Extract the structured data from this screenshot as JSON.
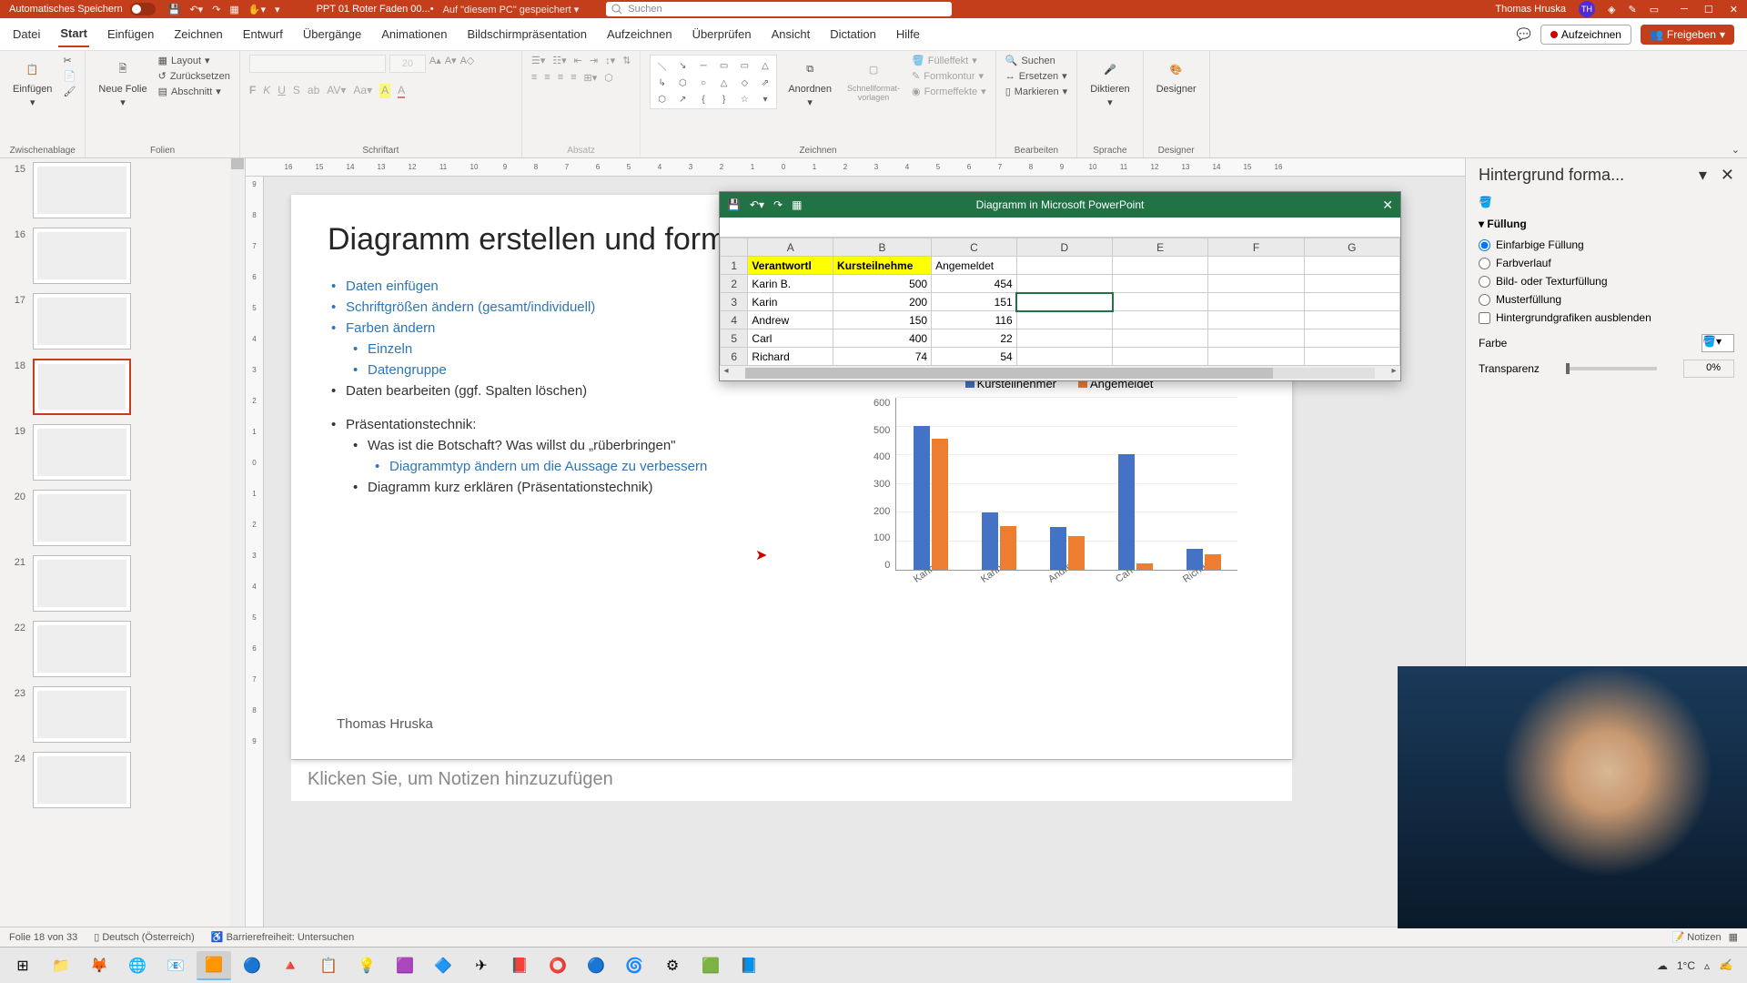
{
  "titlebar": {
    "autosave": "Automatisches Speichern",
    "doc": "PPT 01 Roter Faden 00...",
    "saved": "Auf \"diesem PC\" gespeichert",
    "search_placeholder": "Suchen",
    "user": "Thomas Hruska",
    "initials": "TH"
  },
  "tabs": {
    "items": [
      "Datei",
      "Start",
      "Einfügen",
      "Zeichnen",
      "Entwurf",
      "Übergänge",
      "Animationen",
      "Bildschirmpräsentation",
      "Aufzeichnen",
      "Überprüfen",
      "Ansicht",
      "Dictation",
      "Hilfe"
    ],
    "active": 1,
    "record": "Aufzeichnen",
    "share": "Freigeben"
  },
  "ribbon": {
    "paste": "Einfügen",
    "clipboard": "Zwischenablage",
    "newslide": "Neue Folie",
    "layout": "Layout",
    "reset": "Zurücksetzen",
    "section": "Abschnitt",
    "slides": "Folien",
    "font_size": "20",
    "font_group": "Schriftart",
    "para_group": "Absatz",
    "draw_group": "Zeichnen",
    "arrange": "Anordnen",
    "quickfmt": "Schnellformat-vorlagen",
    "fill": "Fülleffekt",
    "outline": "Formkontur",
    "effects": "Formeffekte",
    "find": "Suchen",
    "replace": "Ersetzen",
    "select": "Markieren",
    "edit_group": "Bearbeiten",
    "dictate": "Diktieren",
    "voice_group": "Sprache",
    "designer": "Designer",
    "designer_group": "Designer"
  },
  "ruler": [
    "16",
    "15",
    "14",
    "13",
    "12",
    "11",
    "10",
    "9",
    "8",
    "7",
    "6",
    "5",
    "4",
    "3",
    "2",
    "1",
    "0",
    "1",
    "2",
    "3",
    "4",
    "5",
    "6",
    "7",
    "8",
    "9",
    "10",
    "11",
    "12",
    "13",
    "14",
    "15",
    "16"
  ],
  "thumbs": [
    {
      "n": "15"
    },
    {
      "n": "16"
    },
    {
      "n": "17"
    },
    {
      "n": "18",
      "active": true
    },
    {
      "n": "19"
    },
    {
      "n": "20"
    },
    {
      "n": "21"
    },
    {
      "n": "22"
    },
    {
      "n": "23"
    },
    {
      "n": "24"
    }
  ],
  "slide": {
    "title": "Diagramm erstellen und formati",
    "b1": "Daten einfügen",
    "b2": "Schriftgrößen ändern (gesamt/individuell)",
    "b3": "Farben ändern",
    "b3a": "Einzeln",
    "b3b": "Datengruppe",
    "b4": "Daten bearbeiten (ggf. Spalten löschen)",
    "b5": "Präsentationstechnik:",
    "b5a": "Was ist die Botschaft? Was willst du „rüberbringen\"",
    "b5a1": "Diagrammtyp ändern um die Aussage zu verbessern",
    "b5b": "Diagramm kurz erklären (Präsentationstechnik)",
    "author": "Thomas Hruska"
  },
  "chart_data": {
    "type": "bar",
    "categories": [
      "Karin B.",
      "Karin",
      "Andrew",
      "Carl",
      "Richard"
    ],
    "series": [
      {
        "name": "Kursteilnehmer",
        "values": [
          500,
          200,
          150,
          400,
          74
        ],
        "color": "#4472c4"
      },
      {
        "name": "Angemeldet",
        "values": [
          454,
          151,
          116,
          22,
          54
        ],
        "color": "#ed7d31"
      }
    ],
    "ylim": [
      0,
      600
    ],
    "yticks": [
      0,
      100,
      200,
      300,
      400,
      500,
      600
    ]
  },
  "datasheet": {
    "title": "Diagramm in Microsoft PowerPoint",
    "cols": [
      "A",
      "B",
      "C",
      "D",
      "E",
      "F",
      "G"
    ],
    "rows": [
      {
        "n": "1",
        "cells": [
          "Verantwortl",
          "Kursteilnehme",
          "Angemeldet",
          "",
          "",
          "",
          ""
        ],
        "hl": [
          0,
          1
        ]
      },
      {
        "n": "2",
        "cells": [
          "Karin B.",
          "500",
          "454",
          "",
          "",
          "",
          ""
        ]
      },
      {
        "n": "3",
        "cells": [
          "Karin",
          "200",
          "151",
          "",
          "",
          "",
          ""
        ],
        "sel": 3
      },
      {
        "n": "4",
        "cells": [
          "Andrew",
          "150",
          "116",
          "",
          "",
          "",
          ""
        ]
      },
      {
        "n": "5",
        "cells": [
          "Carl",
          "400",
          "22",
          "",
          "",
          "",
          ""
        ]
      },
      {
        "n": "6",
        "cells": [
          "Richard",
          "74",
          "54",
          "",
          "",
          "",
          ""
        ]
      }
    ]
  },
  "format": {
    "title": "Hintergrund forma...",
    "fill": "Füllung",
    "opt1": "Einfarbige Füllung",
    "opt2": "Farbverlauf",
    "opt3": "Bild- oder Texturfüllung",
    "opt4": "Musterfüllung",
    "opt5": "Hintergrundgrafiken ausblenden",
    "color": "Farbe",
    "transp": "Transparenz",
    "pct": "0%"
  },
  "notes": "Klicken Sie, um Notizen hinzuzufügen",
  "status": {
    "slide": "Folie 18 von 33",
    "lang": "Deutsch (Österreich)",
    "access": "Barrierefreiheit: Untersuchen",
    "notes": "Notizen"
  },
  "tray": {
    "temp": "1°C"
  }
}
